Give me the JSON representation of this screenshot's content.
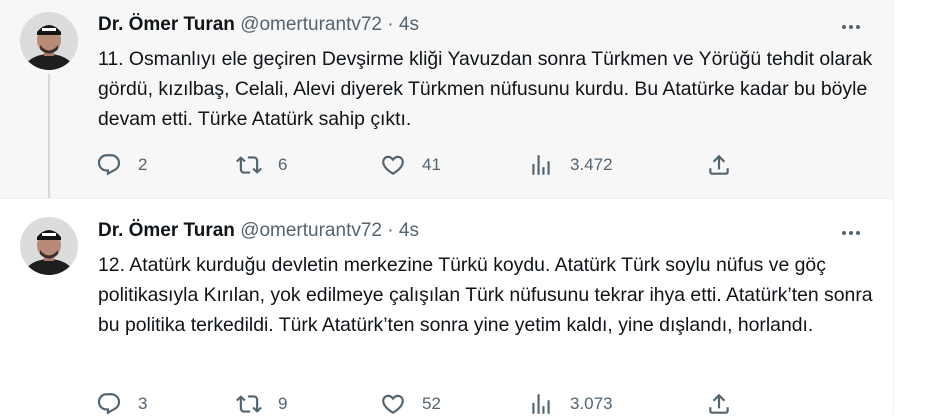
{
  "tweets": [
    {
      "author": {
        "name": "Dr. Ömer Turan",
        "handle": "@omerturantv72"
      },
      "separator": "·",
      "time": "4s",
      "text": "11. Osmanlıyı ele geçiren Devşirme kliği Yavuzdan sonra Türkmen ve Yörüğü tehdit olarak gördü, kızılbaş, Celali, Alevi diyerek Türkmen nüfusunu kurdu. Bu Atatürke kadar bu böyle devam etti. Türke Atatürk sahip çıktı.",
      "replies": "2",
      "retweets": "6",
      "likes": "41",
      "views": "3.472"
    },
    {
      "author": {
        "name": "Dr. Ömer Turan",
        "handle": "@omerturantv72"
      },
      "separator": "·",
      "time": "4s",
      "text": "12. Atatürk kurduğu devletin merkezine Türkü koydu. Atatürk Türk soylu nüfus ve göç politikasıyla Kırılan, yok edilmeye çalışılan Türk nüfusunu tekrar ihya etti. Atatürk’ten sonra bu politika terkedildi. Türk Atatürk’ten sonra yine yetim kaldı, yine dışlandı, horlandı.",
      "replies": "3",
      "retweets": "9",
      "likes": "52",
      "views": "3.073"
    }
  ],
  "icons": {
    "reply": "reply-icon",
    "retweet": "retweet-icon",
    "like": "heart-icon",
    "views": "views-icon",
    "share": "share-icon",
    "more": "more-icon"
  },
  "colors": {
    "text": "#0f1419",
    "secondary": "#536471",
    "thread_line": "#cfd9de"
  }
}
